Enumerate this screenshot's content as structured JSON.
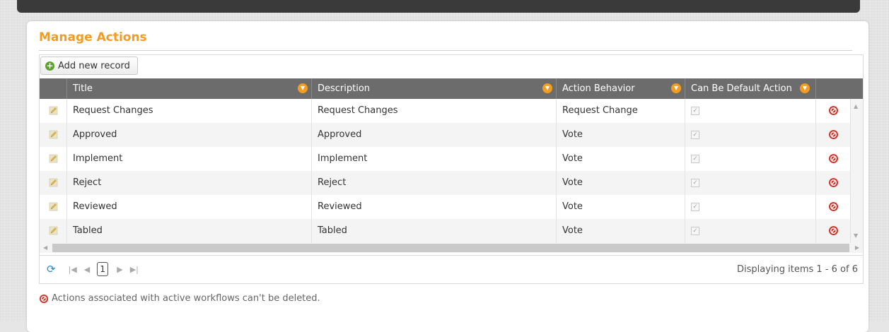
{
  "panel": {
    "title": "Manage Actions",
    "add_button_label": "Add new record"
  },
  "columns": [
    {
      "label": ""
    },
    {
      "label": "Title"
    },
    {
      "label": "Description"
    },
    {
      "label": "Action Behavior"
    },
    {
      "label": "Can Be Default Action"
    }
  ],
  "rows": [
    {
      "title": "Request Changes",
      "description": "Request Changes",
      "behavior": "Request Change",
      "can_be_default": true
    },
    {
      "title": "Approved",
      "description": "Approved",
      "behavior": "Vote",
      "can_be_default": true
    },
    {
      "title": "Implement",
      "description": "Implement",
      "behavior": "Vote",
      "can_be_default": true
    },
    {
      "title": "Reject",
      "description": "Reject",
      "behavior": "Vote",
      "can_be_default": true
    },
    {
      "title": "Reviewed",
      "description": "Reviewed",
      "behavior": "Vote",
      "can_be_default": true
    },
    {
      "title": "Tabled",
      "description": "Tabled",
      "behavior": "Vote",
      "can_be_default": true
    }
  ],
  "pager": {
    "current_page": "1",
    "info": "Displaying items 1 - 6 of 6"
  },
  "footer": {
    "note": "Actions associated with active workflows can't be deleted."
  },
  "colors": {
    "accent": "#f39c1f",
    "header_bg": "#6c6c6c",
    "delete_red": "#d9261c",
    "add_green": "#5aa12e"
  }
}
